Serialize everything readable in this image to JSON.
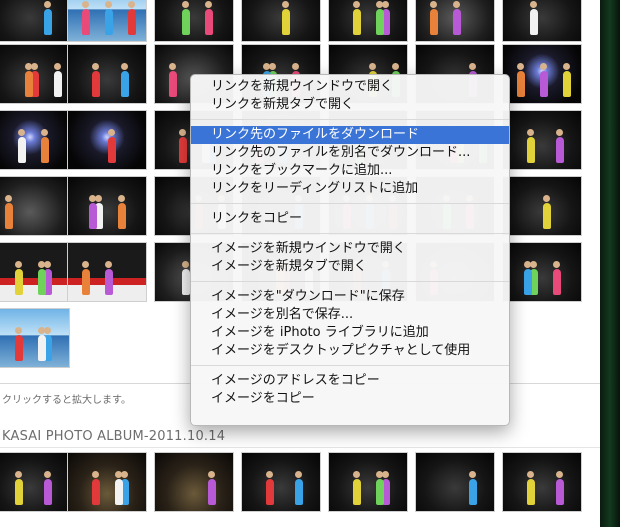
{
  "caption": "クリックすると拡大します。",
  "album_title": "KASAI PHOTO ALBUM-2011.10.14",
  "context_menu": {
    "groups": [
      [
        "リンクを新規ウインドウで開く",
        "リンクを新規タブで開く"
      ],
      [
        "リンク先のファイルをダウンロード",
        "リンク先のファイルを別名でダウンロード...",
        "リンクをブックマークに追加...",
        "リンクをリーディングリストに追加"
      ],
      [
        "リンクをコピー"
      ],
      [
        "イメージを新規ウインドウで開く",
        "イメージを新規タブで開く"
      ],
      [
        "イメージを\"ダウンロード\"に保存",
        "イメージを別名で保存...",
        "イメージを iPhoto ライブラリに追加",
        "イメージをデスクトップピクチャとして使用"
      ],
      [
        "イメージのアドレスをコピー",
        "イメージをコピー"
      ]
    ],
    "highlighted_item": "リンク先のファイルをダウンロード"
  },
  "thumbnail_alt": "photo-thumbnail",
  "accent_color": "#3a74d6"
}
